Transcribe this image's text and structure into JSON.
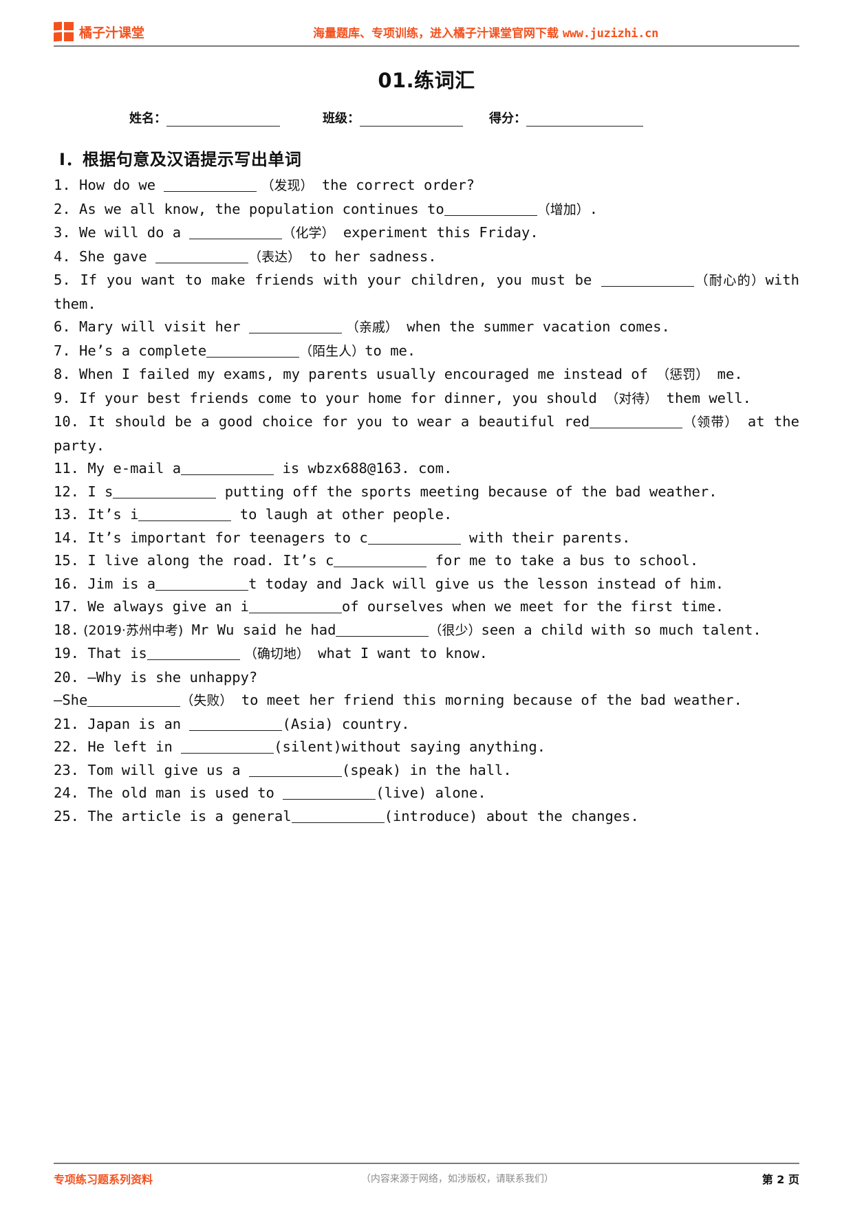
{
  "header": {
    "logo_text": "橘子汁课堂",
    "promo_text": "海量题库、专项训练，进入橘子汁课堂官网下载 ",
    "promo_url": "www.juzizhi.cn"
  },
  "title": "01.练词汇",
  "meta": {
    "name_label": "姓名：",
    "class_label": "班级：",
    "score_label": "得分："
  },
  "section": {
    "heading": "Ⅰ．根据句意及汉语提示写出单词"
  },
  "questions": [
    {
      "num": "1.",
      "parts": [
        {
          "t": "text",
          "v": " How do we "
        },
        {
          "t": "blank",
          "w": "w1"
        },
        {
          "t": "cn",
          "v": " （发现）"
        },
        {
          "t": "text",
          "v": " the correct order?"
        }
      ]
    },
    {
      "num": "2.",
      "parts": [
        {
          "t": "text",
          "v": " As we all know, the population continues to"
        },
        {
          "t": "blank",
          "w": "w1"
        },
        {
          "t": "cn",
          "v": "（增加）"
        },
        {
          "t": "text",
          "v": "."
        }
      ]
    },
    {
      "num": "3.",
      "parts": [
        {
          "t": "text",
          "v": " We will do a "
        },
        {
          "t": "blank",
          "w": "w1"
        },
        {
          "t": "cn",
          "v": "（化学）"
        },
        {
          "t": "text",
          "v": " experiment this Friday."
        }
      ]
    },
    {
      "num": "4.",
      "parts": [
        {
          "t": "text",
          "v": " She gave "
        },
        {
          "t": "blank",
          "w": "w1"
        },
        {
          "t": "cn",
          "v": "（表达）"
        },
        {
          "t": "text",
          "v": " to her sadness."
        }
      ]
    },
    {
      "num": "5.",
      "parts": [
        {
          "t": "text",
          "v": " If you want to make friends with your children, you must be "
        },
        {
          "t": "blank",
          "w": "w1"
        },
        {
          "t": "cn",
          "v": "（耐心的）"
        },
        {
          "t": "text",
          "v": "with them."
        }
      ]
    },
    {
      "num": "6.",
      "parts": [
        {
          "t": "text",
          "v": " Mary will visit her "
        },
        {
          "t": "blank",
          "w": "w1"
        },
        {
          "t": "cn",
          "v": " （亲戚）"
        },
        {
          "t": "text",
          "v": " when the summer vacation comes."
        }
      ]
    },
    {
      "num": "7.",
      "parts": [
        {
          "t": "text",
          "v": " He’s a complete"
        },
        {
          "t": "blank",
          "w": "w1"
        },
        {
          "t": "cn",
          "v": "（陌生人）"
        },
        {
          "t": "text",
          "v": "to me."
        }
      ]
    },
    {
      "num": "8.",
      "parts": [
        {
          "t": "text",
          "v": " When I failed my exams,  my parents usually encouraged me instead of "
        },
        {
          "t": "cn",
          "v": "（惩罚）"
        },
        {
          "t": "text",
          "v": " me."
        }
      ]
    },
    {
      "num": "9.",
      "parts": [
        {
          "t": "text",
          "v": " If your best friends come to your home for dinner, you should "
        },
        {
          "t": "cn",
          "v": "（对待）"
        },
        {
          "t": "text",
          "v": " them well."
        }
      ]
    },
    {
      "num": "10.",
      "parts": [
        {
          "t": "text",
          "v": " It should be a good choice for you to wear a beautiful red"
        },
        {
          "t": "blank",
          "w": "w1"
        },
        {
          "t": "cn",
          "v": "（领带）"
        },
        {
          "t": "text",
          "v": " at the party."
        }
      ]
    },
    {
      "num": "11.",
      "parts": [
        {
          "t": "text",
          "v": " My e-mail a"
        },
        {
          "t": "blank",
          "w": "w1"
        },
        {
          "t": "text",
          "v": " is wbzx688@163. com."
        }
      ]
    },
    {
      "num": "12.",
      "parts": [
        {
          "t": "text",
          "v": " I s"
        },
        {
          "t": "blank",
          "w": "w2"
        },
        {
          "t": "text",
          "v": " putting off the sports meeting because of the bad weather."
        }
      ]
    },
    {
      "num": "13.",
      "parts": [
        {
          "t": "text",
          "v": " It’s i"
        },
        {
          "t": "blank",
          "w": "w1"
        },
        {
          "t": "text",
          "v": " to laugh at other people."
        }
      ]
    },
    {
      "num": "14.",
      "parts": [
        {
          "t": "text",
          "v": " It’s important for teenagers to c"
        },
        {
          "t": "blank",
          "w": "w1"
        },
        {
          "t": "text",
          "v": " with their parents."
        }
      ]
    },
    {
      "num": "15.",
      "parts": [
        {
          "t": "text",
          "v": " I live along the road. It’s c"
        },
        {
          "t": "blank",
          "w": "w1"
        },
        {
          "t": "text",
          "v": " for me to take a bus to school."
        }
      ]
    },
    {
      "num": "16.",
      "parts": [
        {
          "t": "text",
          "v": " Jim is a"
        },
        {
          "t": "blank",
          "w": "w1"
        },
        {
          "t": "text",
          "v": "t today and Jack will give us the lesson instead of him."
        }
      ]
    },
    {
      "num": "17.",
      "parts": [
        {
          "t": "text",
          "v": " We always give an i"
        },
        {
          "t": "blank",
          "w": "w1"
        },
        {
          "t": "text",
          "v": "of ourselves when we meet for the first time."
        }
      ]
    },
    {
      "num": "18.",
      "parts": [
        {
          "t": "cn",
          "v": " (2019·苏州中考)"
        },
        {
          "t": "text",
          "v": " Mr Wu said he had"
        },
        {
          "t": "blank",
          "w": "w1"
        },
        {
          "t": "cn",
          "v": "（很少）"
        },
        {
          "t": "text",
          "v": "seen a child with so much talent."
        }
      ]
    },
    {
      "num": "19.",
      "parts": [
        {
          "t": "text",
          "v": " That is"
        },
        {
          "t": "blank",
          "w": "w1"
        },
        {
          "t": "cn",
          "v": " （确切地）"
        },
        {
          "t": "text",
          "v": " what I want to know."
        }
      ]
    },
    {
      "num": "20.",
      "parts": [
        {
          "t": "text",
          "v": " —Why is she unhappy?"
        }
      ]
    },
    {
      "num": "",
      "parts": [
        {
          "t": "text",
          "v": "—She"
        },
        {
          "t": "blank",
          "w": "w1"
        },
        {
          "t": "cn",
          "v": "（失败）"
        },
        {
          "t": "text",
          "v": " to meet her friend this morning because of the bad weather."
        }
      ]
    },
    {
      "num": "21.",
      "parts": [
        {
          "t": "text",
          "v": " Japan is an "
        },
        {
          "t": "blank",
          "w": "w1"
        },
        {
          "t": "text",
          "v": "(Asia) country."
        }
      ]
    },
    {
      "num": "22.",
      "parts": [
        {
          "t": "text",
          "v": " He left in "
        },
        {
          "t": "blank",
          "w": "w1"
        },
        {
          "t": "text",
          "v": "(silent)without saying anything."
        }
      ]
    },
    {
      "num": "23.",
      "parts": [
        {
          "t": "text",
          "v": " Tom will give us a "
        },
        {
          "t": "blank",
          "w": "w1"
        },
        {
          "t": "text",
          "v": "(speak) in the hall."
        }
      ]
    },
    {
      "num": "24.",
      "parts": [
        {
          "t": "text",
          "v": " The old man is used to "
        },
        {
          "t": "blank",
          "w": "w1"
        },
        {
          "t": "text",
          "v": "(live) alone."
        }
      ]
    },
    {
      "num": "25.",
      "parts": [
        {
          "t": "text",
          "v": " The article is a general"
        },
        {
          "t": "blank",
          "w": "w1"
        },
        {
          "t": "text",
          "v": "(introduce) about the changes."
        }
      ]
    }
  ],
  "footer": {
    "left": "专项练习题系列资料",
    "center": "（内容来源于网络，如涉版权，请联系我们）",
    "right": "第 2 页"
  }
}
